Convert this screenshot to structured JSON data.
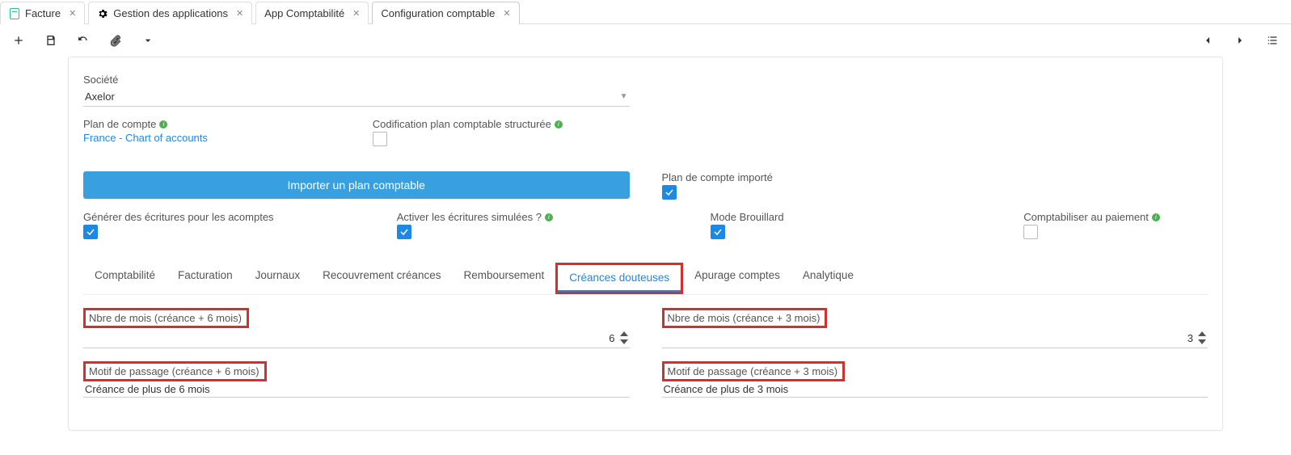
{
  "tabs": [
    {
      "label": "Facture",
      "icon": "doc"
    },
    {
      "label": "Gestion des applications",
      "icon": "gear"
    },
    {
      "label": "App Comptabilité",
      "icon": ""
    },
    {
      "label": "Configuration comptable",
      "icon": "",
      "active": true
    }
  ],
  "form": {
    "societe": {
      "label": "Société",
      "value": "Axelor"
    },
    "plan_compte": {
      "label": "Plan de compte",
      "value": "France - Chart of accounts"
    },
    "codification": {
      "label": "Codification plan comptable structurée"
    },
    "import_btn": "Importer un plan comptable",
    "plan_importe": {
      "label": "Plan de compte importé",
      "checked": true
    },
    "flags": {
      "gen_acomptes": {
        "label": "Générer des écritures pour les acomptes",
        "checked": true
      },
      "ecritures_sim": {
        "label": "Activer les écritures simulées ?",
        "checked": true
      },
      "brouillard": {
        "label": "Mode Brouillard",
        "checked": true
      },
      "compta_paiement": {
        "label": "Comptabiliser au paiement",
        "checked": false
      }
    }
  },
  "inner_tabs": [
    "Comptabilité",
    "Facturation",
    "Journaux",
    "Recouvrement créances",
    "Remboursement",
    "Créances douteuses",
    "Apurage comptes",
    "Analytique"
  ],
  "inner_tabs_active": "Créances douteuses",
  "creances": {
    "nb6": {
      "label": "Nbre de mois (créance + 6 mois)",
      "value": "6"
    },
    "nb3": {
      "label": "Nbre de mois (créance + 3 mois)",
      "value": "3"
    },
    "motif6": {
      "label": "Motif de passage (créance + 6 mois)",
      "value": "Créance de plus de 6 mois"
    },
    "motif3": {
      "label": "Motif de passage (créance + 3 mois)",
      "value": "Créance de plus de 3 mois"
    }
  }
}
